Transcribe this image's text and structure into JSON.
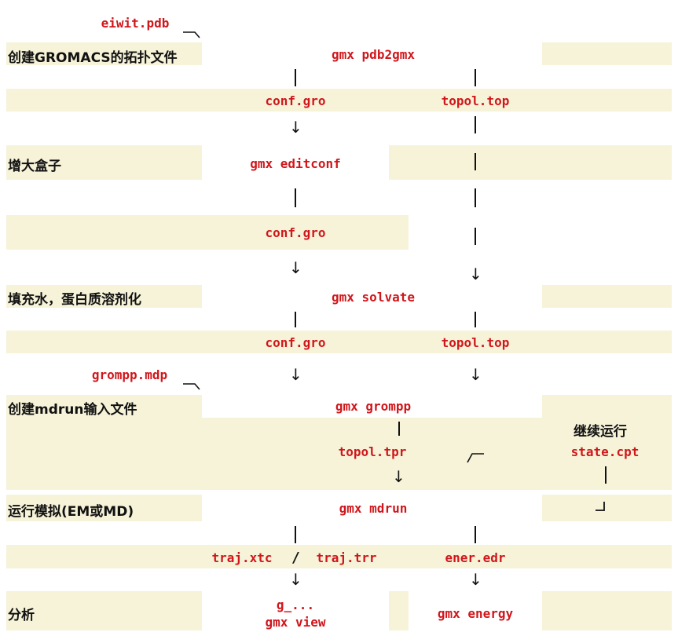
{
  "steps": {
    "topology": "创建GROMACS的拓扑文件",
    "box": "增大盒子",
    "solvate": "填充水，蛋白质溶剂化",
    "mdrun_input": "创建mdrun输入文件",
    "run": "运行模拟(EM或MD)",
    "analysis": "分析",
    "continue": "继续运行"
  },
  "commands": {
    "pdb2gmx": "gmx pdb2gmx",
    "editconf": "gmx editconf",
    "solvate": "gmx solvate",
    "grompp": "gmx grompp",
    "mdrun": "gmx mdrun",
    "g_tools": "g_...",
    "view": "gmx view",
    "energy": "gmx energy"
  },
  "files": {
    "input_pdb": "eiwit.pdb",
    "conf_gro": "conf.gro",
    "topol_top": "topol.top",
    "grompp_mdp": "grompp.mdp",
    "topol_tpr": "topol.tpr",
    "state_cpt": "state.cpt",
    "traj_xtc": "traj.xtc",
    "traj_trr": "traj.trr",
    "ener_edr": "ener.edr",
    "separator": "/"
  },
  "colors": {
    "band": "#f6f3d9",
    "box": "#ffffff",
    "text_red": "#d0161b"
  }
}
